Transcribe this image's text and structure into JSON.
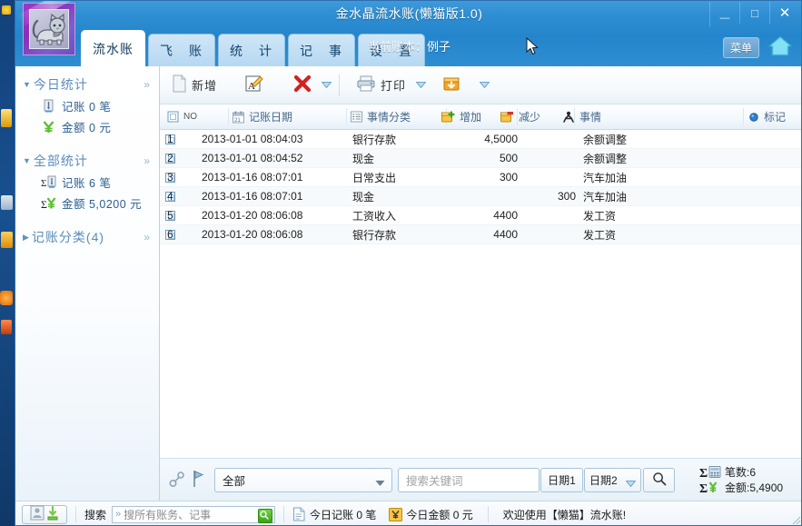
{
  "window": {
    "title": "金水晶流水账(懒猫版1.0)",
    "minimize": "—",
    "maximize": "□",
    "close": "✕"
  },
  "header": {
    "ledger_label": "当前账本：例子",
    "menu_button": "菜单",
    "tabs": [
      {
        "label": "流水账",
        "active": true
      },
      {
        "label": "飞　账",
        "active": false
      },
      {
        "label": "统　计",
        "active": false
      },
      {
        "label": "记　事",
        "active": false
      },
      {
        "label": "设　置",
        "active": false
      }
    ]
  },
  "sidebar": {
    "groups": [
      {
        "title": "今日统计",
        "expanded": true,
        "chevron": "»",
        "items": [
          {
            "icon": "pen-icon",
            "label": "记账 0 笔"
          },
          {
            "icon": "yen-icon",
            "label": "金额 0 元"
          }
        ]
      },
      {
        "title": "全部统计",
        "expanded": true,
        "chevron": "»",
        "items": [
          {
            "icon": "sigma-pen-icon",
            "label": "记账 6 笔"
          },
          {
            "icon": "sigma-yen-icon",
            "label": "金额 5,0200 元"
          }
        ]
      },
      {
        "title": "记账分类(4)",
        "expanded": false,
        "chevron": "»",
        "items": []
      }
    ]
  },
  "toolbar": {
    "new_label": "新增",
    "print_label": "打印",
    "edit_icon": "edit-note-icon",
    "delete_icon": "delete-x-icon",
    "export_icon": "export-box-icon",
    "dropdown_arrow": "▼"
  },
  "table": {
    "columns": [
      {
        "key": "no",
        "label": "NO",
        "icon": "checkbox-icon"
      },
      {
        "key": "date",
        "label": "记账日期",
        "icon": "calendar-icon"
      },
      {
        "key": "cat",
        "label": "事情分类",
        "icon": "list-icon"
      },
      {
        "key": "inc",
        "label": "增加",
        "icon": "increase-icon"
      },
      {
        "key": "dec",
        "label": "减少",
        "icon": "decrease-icon"
      },
      {
        "key": "thing",
        "label": "事情",
        "icon": "person-icon"
      },
      {
        "key": "mark",
        "label": "标记",
        "icon": "dot-icon"
      }
    ],
    "rows": [
      {
        "no": "1",
        "date": "2013-01-01 08:04:03",
        "cat": "银行存款",
        "inc": "4,5000",
        "dec": "",
        "thing": "余额调整",
        "mark": ""
      },
      {
        "no": "2",
        "date": "2013-01-01 08:04:52",
        "cat": "现金",
        "inc": "500",
        "dec": "",
        "thing": "余额调整",
        "mark": ""
      },
      {
        "no": "3",
        "date": "2013-01-16 08:07:01",
        "cat": "日常支出",
        "inc": "300",
        "dec": "",
        "thing": "汽车加油",
        "mark": ""
      },
      {
        "no": "4",
        "date": "2013-01-16 08:07:01",
        "cat": "现金",
        "inc": "",
        "dec": "300",
        "thing": "汽车加油",
        "mark": ""
      },
      {
        "no": "5",
        "date": "2013-01-20 08:06:08",
        "cat": "工资收入",
        "inc": "4400",
        "dec": "",
        "thing": "发工资",
        "mark": ""
      },
      {
        "no": "6",
        "date": "2013-01-20 08:06:08",
        "cat": "银行存款",
        "inc": "4400",
        "dec": "",
        "thing": "发工资",
        "mark": ""
      }
    ]
  },
  "filterbar": {
    "category_value": "全部",
    "search_placeholder": "搜索关键词",
    "date1_label": "日期1",
    "date2_label": "日期2",
    "search_icon": "magnifier-icon",
    "count_label": "笔数:6",
    "amount_label": "金额:5,4900"
  },
  "statusbar": {
    "search_label": "搜索",
    "search_placeholder": "搜所有账务、记事",
    "search_prefix": "»",
    "today_records": "今日记账 0 笔",
    "today_amount": "今日金额 0 元",
    "welcome": "欢迎使用【懒猫】流水账!"
  },
  "colors": {
    "title_bar": "#2485cc",
    "accent": "#2b5e90",
    "sidebar_head": "#5b8cba",
    "delete_red": "#d42020",
    "export_orange": "#f0a41e"
  }
}
